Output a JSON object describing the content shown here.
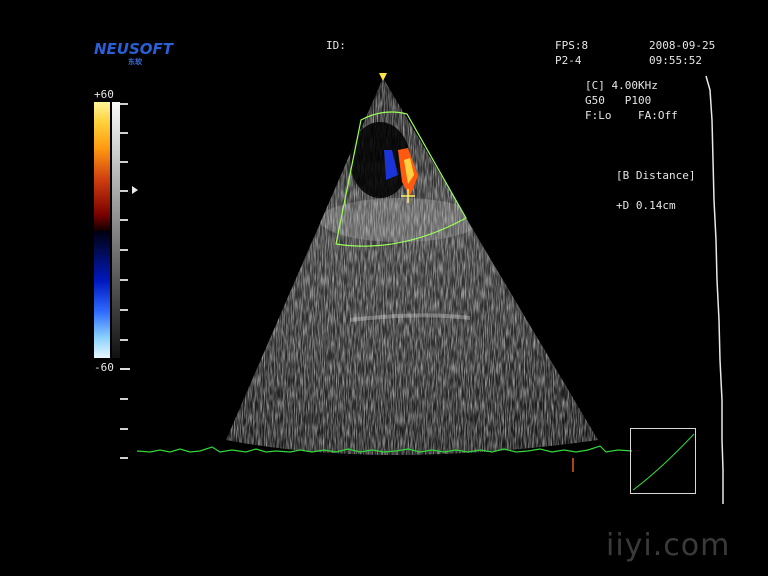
{
  "header": {
    "logo": "NEUSOFT",
    "logo_sub": "东软",
    "id_label": "ID:",
    "fps": "FPS:8",
    "probe": "P2-4",
    "date": "2008-09-25",
    "time": "09:55:52"
  },
  "params": {
    "color_freq": "[C] 4.00KHz",
    "gain_power": "G50   P100",
    "filter": "F:Lo    FA:Off"
  },
  "measurement": {
    "title": "[B Distance]",
    "value": "+D 0.14cm"
  },
  "color_scale": {
    "top": "+60",
    "bottom": "-60"
  },
  "watermark": "iiyi.com",
  "colors": {
    "ecg_trace": "#33d63a",
    "roi_box": "#9bff5a",
    "logo": "#2a5fd6"
  }
}
